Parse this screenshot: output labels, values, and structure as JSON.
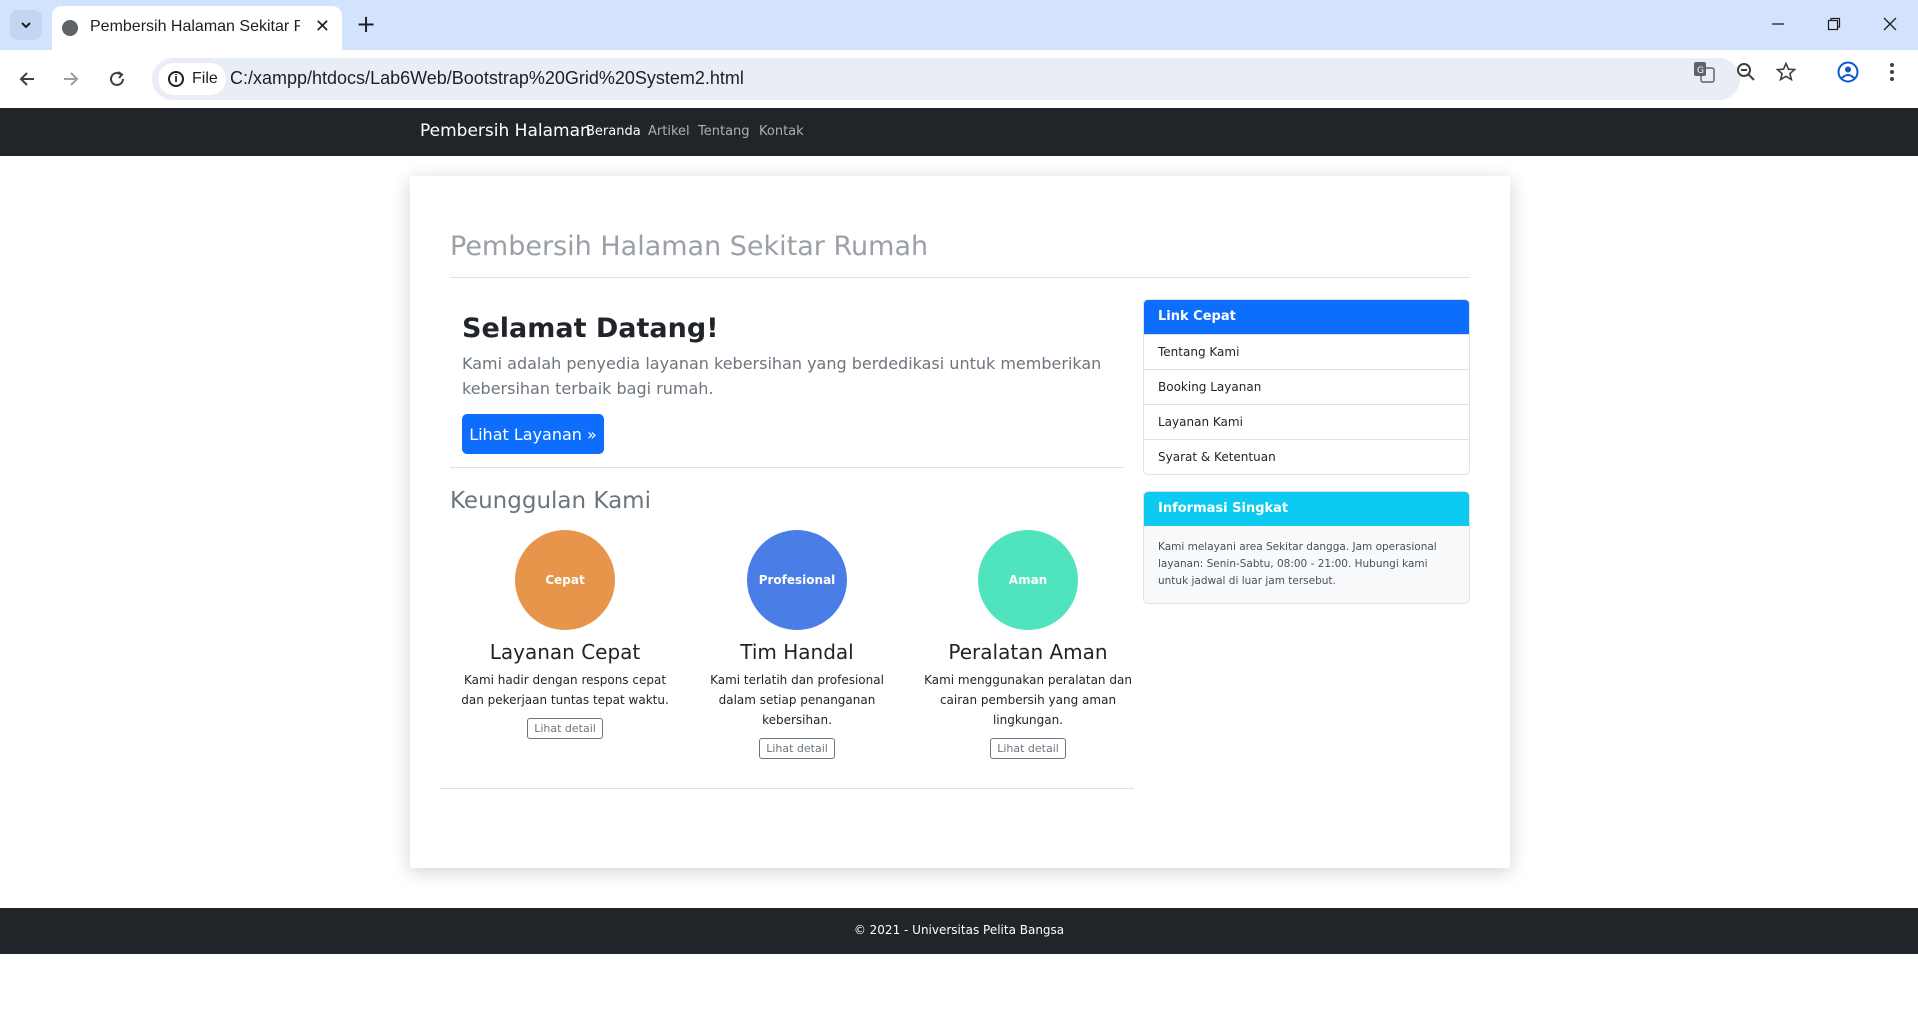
{
  "browser": {
    "tab_title": "Pembersih Halaman Sekitar Rumah",
    "address_chip": "File",
    "url": "C:/xampp/htdocs/Lab6Web/Bootstrap%20Grid%20System2.html"
  },
  "navbar": {
    "brand": "Pembersih Halaman",
    "links": [
      "Beranda",
      "Artikel",
      "Tentang",
      "Kontak"
    ]
  },
  "main": {
    "page_title": "Pembersih Halaman Sekitar Rumah",
    "welcome": {
      "heading": "Selamat Datang!",
      "text": "Kami adalah penyedia layanan kebersihan yang berdedikasi untuk memberikan kebersihan terbaik bagi rumah.",
      "button": "Lihat Layanan »"
    },
    "features_heading": "Keunggulan Kami",
    "features": [
      {
        "badge": "Cepat",
        "title": "Layanan Cepat",
        "text": "Kami hadir dengan respons cepat dan pekerjaan tuntas tepat waktu.",
        "button": "Lihat detail",
        "color": "#e6954b"
      },
      {
        "badge": "Profesional",
        "title": "Tim Handal",
        "text": "Kami terlatih dan profesional dalam setiap penanganan kebersihan.",
        "button": "Lihat detail",
        "color": "#4a7ee6"
      },
      {
        "badge": "Aman",
        "title": "Peralatan Aman",
        "text": "Kami menggunakan peralatan dan cairan pembersih yang aman lingkungan.",
        "button": "Lihat detail",
        "color": "#4fe3be"
      }
    ]
  },
  "sidebar": {
    "quick_links": {
      "title": "Link Cepat",
      "header_color": "#0d6efd",
      "items": [
        "Tentang Kami",
        "Booking Layanan",
        "Layanan Kami",
        "Syarat & Ketentuan"
      ]
    },
    "info": {
      "title": "Informasi Singkat",
      "header_color": "#0dcaf0",
      "text": "Kami melayani area Sekitar dangga. Jam operasional layanan: Senin-Sabtu, 08:00 - 21:00. Hubungi kami untuk jadwal di luar jam tersebut."
    }
  },
  "footer": {
    "text": "© 2021 - Universitas Pelita Bangsa"
  }
}
